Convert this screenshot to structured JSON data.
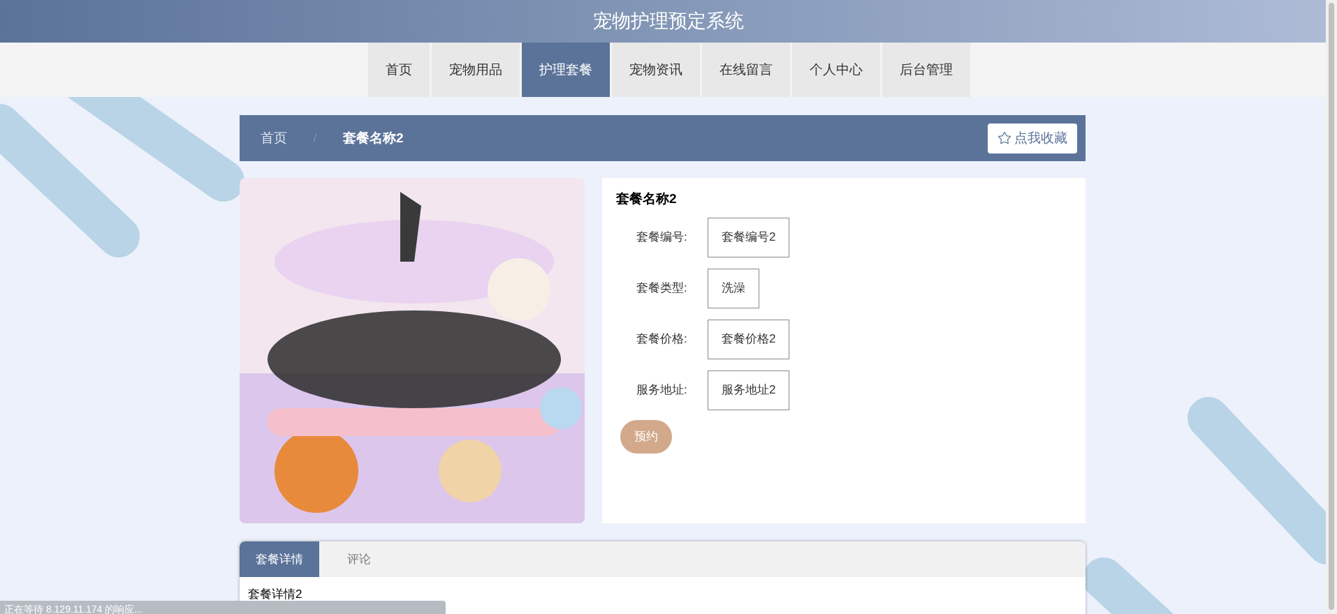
{
  "header": {
    "title": "宠物护理预定系统"
  },
  "nav": [
    {
      "label": "首页",
      "selected": false
    },
    {
      "label": "宠物用品",
      "selected": false
    },
    {
      "label": "护理套餐",
      "selected": true
    },
    {
      "label": "宠物资讯",
      "selected": false
    },
    {
      "label": "在线留言",
      "selected": false
    },
    {
      "label": "个人中心",
      "selected": false
    },
    {
      "label": "后台管理",
      "selected": false
    }
  ],
  "breadcrumb": {
    "items": [
      "首页",
      "套餐名称2"
    ],
    "separator": "/",
    "favorite_button": "点我收藏"
  },
  "product": {
    "title": "套餐名称2",
    "fields": [
      {
        "label": "套餐编号:",
        "value": "套餐编号2"
      },
      {
        "label": "套餐类型:",
        "value": "洗澡"
      },
      {
        "label": "套餐价格:",
        "value": "套餐价格2"
      },
      {
        "label": "服务地址:",
        "value": "服务地址2"
      }
    ],
    "book_button": "预约"
  },
  "tabs": [
    {
      "label": "套餐详情",
      "selected": true
    },
    {
      "label": "评论",
      "selected": false
    }
  ],
  "tab_content": "套餐详情2",
  "status_bar": "正在等待 8.129.11.174 的响应..."
}
